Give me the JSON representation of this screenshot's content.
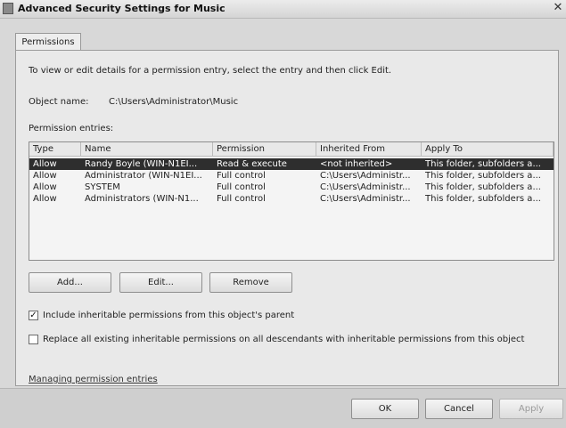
{
  "window": {
    "title": "Advanced Security Settings for Music",
    "close_glyph": "✕"
  },
  "tabs": [
    {
      "label": "Permissions",
      "active": true
    }
  ],
  "instructions": "To view or edit details for a permission entry, select the entry and then click Edit.",
  "object": {
    "label": "Object name:",
    "value": "C:\\Users\\Administrator\\Music"
  },
  "entries_label": "Permission entries:",
  "columns": [
    "Type",
    "Name",
    "Permission",
    "Inherited From",
    "Apply To"
  ],
  "rows": [
    {
      "type": "Allow",
      "name": "Randy Boyle (WIN-N1EI...",
      "permission": "Read & execute",
      "inherited_from": "<not inherited>",
      "apply_to": "This folder, subfolders a...",
      "selected": true
    },
    {
      "type": "Allow",
      "name": "Administrator (WIN-N1EI...",
      "permission": "Full control",
      "inherited_from": "C:\\Users\\Administr...",
      "apply_to": "This folder, subfolders a...",
      "selected": false
    },
    {
      "type": "Allow",
      "name": "SYSTEM",
      "permission": "Full control",
      "inherited_from": "C:\\Users\\Administr...",
      "apply_to": "This folder, subfolders a...",
      "selected": false
    },
    {
      "type": "Allow",
      "name": "Administrators (WIN-N1...",
      "permission": "Full control",
      "inherited_from": "C:\\Users\\Administr...",
      "apply_to": "This folder, subfolders a...",
      "selected": false
    }
  ],
  "buttons": {
    "add": "Add...",
    "edit": "Edit...",
    "remove": "Remove"
  },
  "options": {
    "include_inheritable": {
      "label": "Include inheritable permissions from this object's parent",
      "checked": true,
      "mark": "✓"
    },
    "replace_all": {
      "label": "Replace all existing inheritable permissions on all descendants with inheritable permissions from this object",
      "checked": false,
      "mark": ""
    }
  },
  "help_link": "Managing permission entries",
  "footer": {
    "ok": "OK",
    "cancel": "Cancel",
    "apply": "Apply",
    "apply_enabled": false
  },
  "colors": {
    "selection": "#2e2e2e",
    "dialog_bg": "#d8d8d8"
  },
  "icons": [
    "folder-icon",
    "close-icon",
    "checkbox-checked-icon"
  ]
}
